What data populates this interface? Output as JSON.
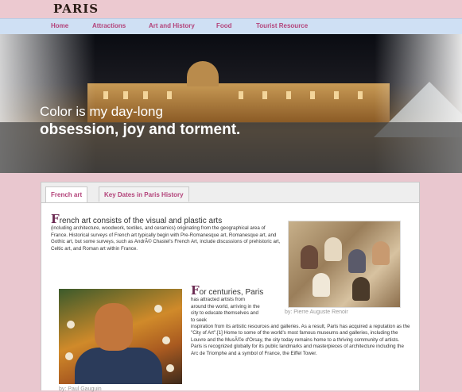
{
  "header": {
    "logo": "PARIS"
  },
  "nav": {
    "items": [
      {
        "label": "Home"
      },
      {
        "label": "Attractions"
      },
      {
        "label": "Art and History"
      },
      {
        "label": "Food"
      },
      {
        "label": "Tourist Resource"
      }
    ]
  },
  "hero": {
    "caption_line1": "Color is my day-long",
    "caption_line2": "obsession, joy and torment."
  },
  "tabs": [
    {
      "label": "French art",
      "active": true
    },
    {
      "label": "Key Dates in Paris History",
      "active": false
    }
  ],
  "content": {
    "para1_initial": "F",
    "para1_lead": "rench art consists of the visual and plastic arts",
    "para1_rest": "(including architecture, woodwork, textiles, and ceramics) originating from the geographical area of France. Historical surveys of French art typically begin with Pre-Romanesque art, Romanesque art, and Gothic art, but some surveys, such as AndrÃ© Chastel's French Art, include discussions of prehistoric art, Celtic art, and Roman art within France.",
    "para2_initial": "F",
    "para2_lead": "or centuries, Paris",
    "para2_narrow": "has attracted artists from around the world, arriving in the city to educate themselves and to seek",
    "para2_rest": "inspiration from its artistic resources and galleries. As a result, Paris has acquired a reputation as the \"City of Art\".[1] Home to some of the world's most famous museums and galleries, including the Louvre and the MusÃ©e d'Orsay, the city today remains home to a thriving community of artists. Paris is recognized globally for its public landmarks and masterpieces of architecture including the Arc de Triomphe and a symbol of France, the Eiffel Tower.",
    "image1_caption": "by: Pierre Auguste Renoir",
    "image2_caption": "by: Paul Gauguin"
  }
}
